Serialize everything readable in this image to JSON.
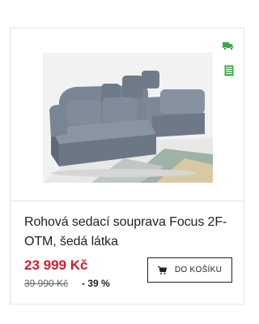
{
  "product": {
    "title": "Rohová sedací souprava Focus 2F-OTM, šedá látka",
    "price": "23 999 Kč",
    "old_price": "39 990 Kč",
    "discount": "- 39 %",
    "cart_label": "DO KOŠÍKU",
    "image_alt": "grey corner sofa",
    "delivery_icon": "truck-icon",
    "stock_icon": "warehouse-icon"
  },
  "colors": {
    "price": "#d71a2a",
    "badge_green": "#3aa846",
    "border": "#e4e4e4"
  }
}
